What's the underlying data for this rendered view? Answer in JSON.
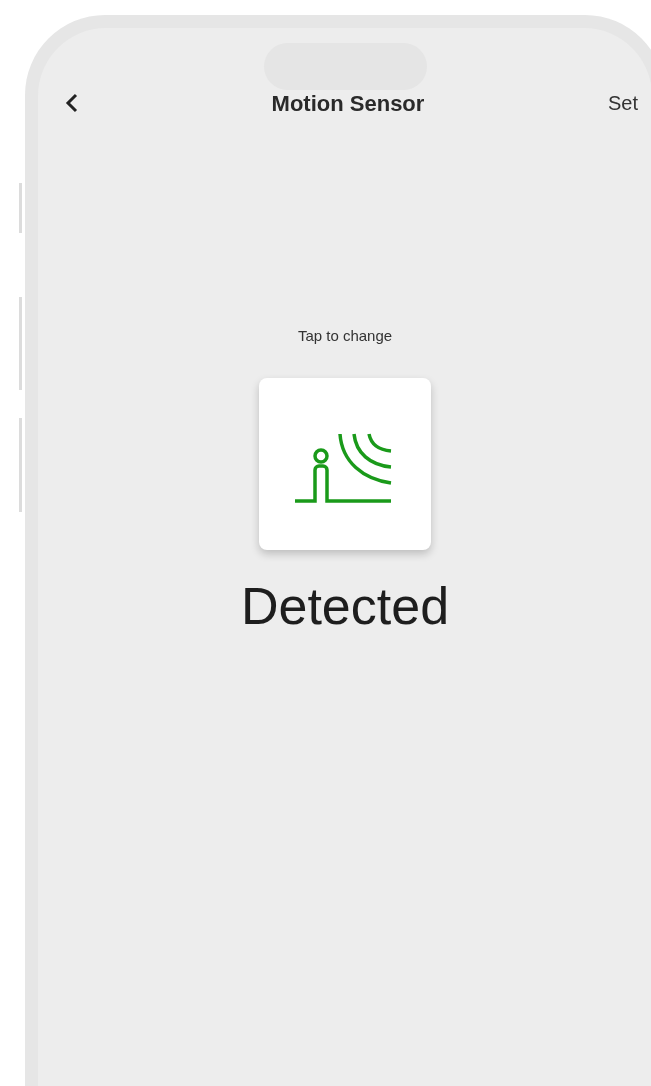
{
  "header": {
    "title": "Motion Sensor",
    "action": "Set"
  },
  "sensor": {
    "hint": "Tap to change",
    "detected": true,
    "status": "Detected"
  }
}
